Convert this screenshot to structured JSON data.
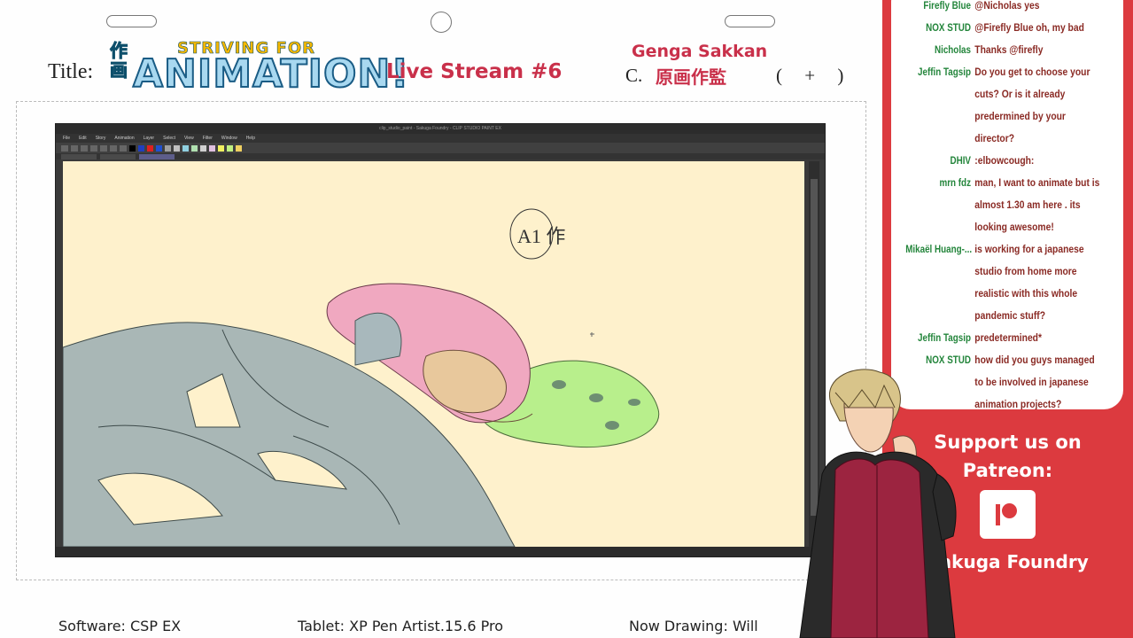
{
  "header": {
    "title_label": "Title:",
    "logo_kanji": "作画",
    "logo_sub": "STRIVING FOR",
    "logo_main": "ANIMATION!",
    "stream_title": "Live Stream #6",
    "role_name": "Genga Sakkan",
    "role_prefix": "C.",
    "role_kanji": "原画作監",
    "role_paren": "( + )"
  },
  "app": {
    "window_title": "clip_studio_paint - Sakuga Foundry - CLIP STUDIO PAINT EX",
    "menu": [
      "File",
      "Edit",
      "Story",
      "Animation",
      "Layer",
      "Select",
      "View",
      "Filter",
      "Window",
      "Help"
    ]
  },
  "canvas": {
    "annotation": "A1 作"
  },
  "chat": {
    "messages": [
      {
        "user": "Firefly Blue",
        "text": "@Nicholas yes"
      },
      {
        "user": "NOX STUD",
        "text": "@Firefly Blue oh, my bad"
      },
      {
        "user": "Nicholas",
        "text": "Thanks @firefly"
      },
      {
        "user": "Jeffin Tagsip",
        "text": "Do you get to choose your cuts? Or is it already predermined by your director?"
      },
      {
        "user": "DHIV",
        "text": ":elbowcough:"
      },
      {
        "user": "mrn fdz",
        "text": "man, I want to animate but is almost 1.30 am here . its looking awesome!"
      },
      {
        "user": "Mikaël Huang-...",
        "text": "is working for a japanese studio from home more realistic with this whole pandemic stuff?"
      },
      {
        "user": "Jeffin Tagsip",
        "text": "predetermined*"
      },
      {
        "user": "NOX STUD",
        "text": "how did you guys managed to be involved in japanese animation projects?"
      }
    ]
  },
  "support": {
    "heading": "Support us on Patreon:",
    "name": "Sakuga Foundry"
  },
  "footer": {
    "software": "Software: CSP EX",
    "tablet": "Tablet:  XP Pen Artist.15.6 Pro",
    "drawing": "Now Drawing: Will"
  },
  "colors": {
    "panel_red": "#dc3a3f",
    "accent_text": "#c9304a",
    "chat_user": "#23853b",
    "chat_text": "#8a2a24",
    "canvas_paper": "#fef1cc",
    "palette": [
      "#000000",
      "#1f3fbf",
      "#e02020",
      "#2050d0",
      "#a0a0a0",
      "#c0c0c0",
      "#90d0e0",
      "#b0e0b0",
      "#d0d0d0",
      "#e0c0e0",
      "#f0f060",
      "#c0f080",
      "#f0d060"
    ]
  }
}
